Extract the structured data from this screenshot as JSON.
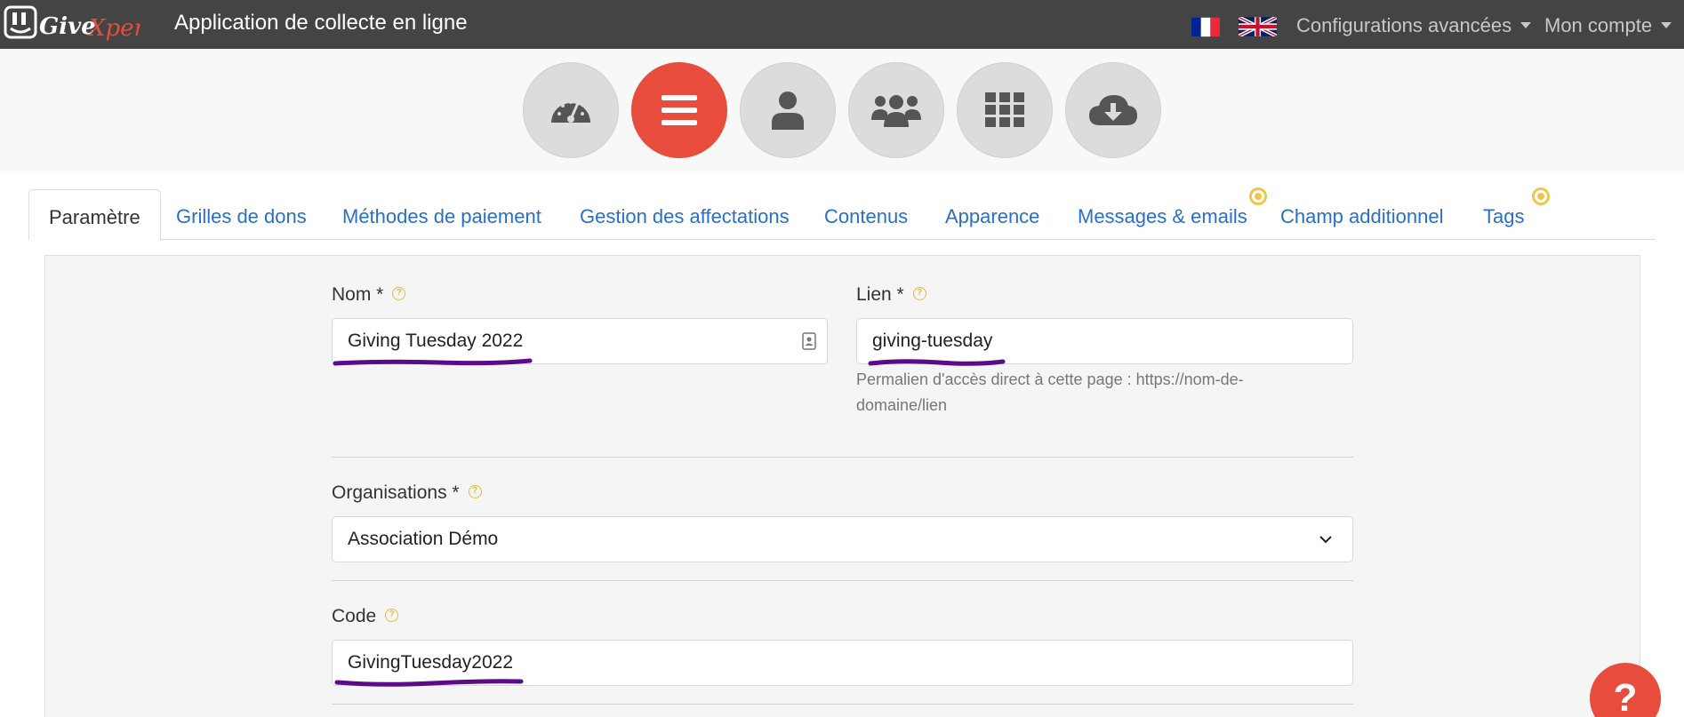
{
  "header": {
    "logo_text": "GiveXpert",
    "app_title": "Application de collecte en ligne",
    "nav": {
      "advanced_config": "Configurations avancées",
      "account": "Mon compte"
    },
    "languages": [
      "fr",
      "en"
    ]
  },
  "toolbar": {
    "icons": [
      "dashboard-gauge-icon",
      "menu-icon",
      "user-icon",
      "users-group-icon",
      "grid-icon",
      "cloud-download-icon"
    ],
    "active": "menu-icon",
    "accent_color": "#e74c3c"
  },
  "tabs": [
    {
      "label": "Paramètre",
      "active": true
    },
    {
      "label": "Grilles de dons"
    },
    {
      "label": "Méthodes de paiement"
    },
    {
      "label": "Gestion des affectations"
    },
    {
      "label": "Contenus"
    },
    {
      "label": "Apparence"
    },
    {
      "label": "Messages & emails"
    },
    {
      "label": "Champ additionnel"
    },
    {
      "label": "Tags"
    }
  ],
  "form": {
    "nom": {
      "label": "Nom *",
      "value": "Giving Tuesday 2022"
    },
    "lien": {
      "label": "Lien *",
      "value": "giving-tuesday",
      "hint": "Permalien d'accès direct à cette page : https://nom-de-domaine/lien"
    },
    "organisations": {
      "label": "Organisations *",
      "value": "Association Démo"
    },
    "code": {
      "label": "Code",
      "value": "GivingTuesday2022"
    }
  },
  "help_button": "?"
}
